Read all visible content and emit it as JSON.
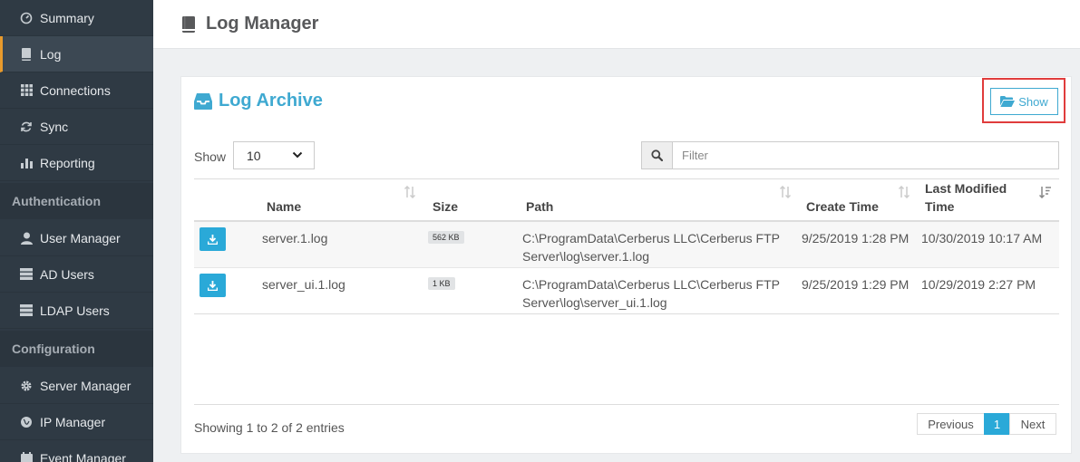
{
  "sidebar": {
    "items": [
      {
        "label": "Summary",
        "icon": "dashboard-icon"
      },
      {
        "label": "Log",
        "icon": "book-icon",
        "active": true
      },
      {
        "label": "Connections",
        "icon": "grid-icon"
      },
      {
        "label": "Sync",
        "icon": "refresh-icon"
      },
      {
        "label": "Reporting",
        "icon": "bar-chart-icon"
      }
    ],
    "auth_section": "Authentication",
    "auth_items": [
      {
        "label": "User Manager",
        "icon": "user-icon"
      },
      {
        "label": "AD Users",
        "icon": "server-icon"
      },
      {
        "label": "LDAP Users",
        "icon": "server-icon"
      }
    ],
    "config_section": "Configuration",
    "config_items": [
      {
        "label": "Server Manager",
        "icon": "gear-icon"
      },
      {
        "label": "IP Manager",
        "icon": "globe-icon"
      },
      {
        "label": "Event Manager",
        "icon": "calendar-icon"
      }
    ]
  },
  "header": {
    "title": "Log Manager"
  },
  "panel": {
    "title": "Log Archive",
    "show_button": "Show",
    "show_label": "Show",
    "page_size": "10",
    "filter_placeholder": "Filter"
  },
  "table": {
    "columns": [
      "Name",
      "Size",
      "Path",
      "Create Time",
      "Last Modified Time"
    ],
    "rows": [
      {
        "name": "server.1.log",
        "size": "562 KB",
        "path_line1": "C:\\ProgramData\\Cerberus LLC\\Cerberus FTP",
        "path_line2": "Server\\log\\server.1.log",
        "created": "9/25/2019 1:28 PM",
        "modified": "10/30/2019 10:17 AM"
      },
      {
        "name": "server_ui.1.log",
        "size": "1 KB",
        "path_line1": "C:\\ProgramData\\Cerberus LLC\\Cerberus FTP",
        "path_line2": "Server\\log\\server_ui.1.log",
        "created": "9/25/2019 1:29 PM",
        "modified": "10/29/2019 2:27 PM"
      }
    ]
  },
  "footer": {
    "entries": "Showing 1 to 2 of 2 entries",
    "prev": "Previous",
    "page": "1",
    "next": "Next"
  },
  "colors": {
    "sidebar_bg": "#2f3a44",
    "accent_blue": "#2aa9d8",
    "active_marker": "#e89a2c",
    "highlight_red": "#e03c3c"
  }
}
